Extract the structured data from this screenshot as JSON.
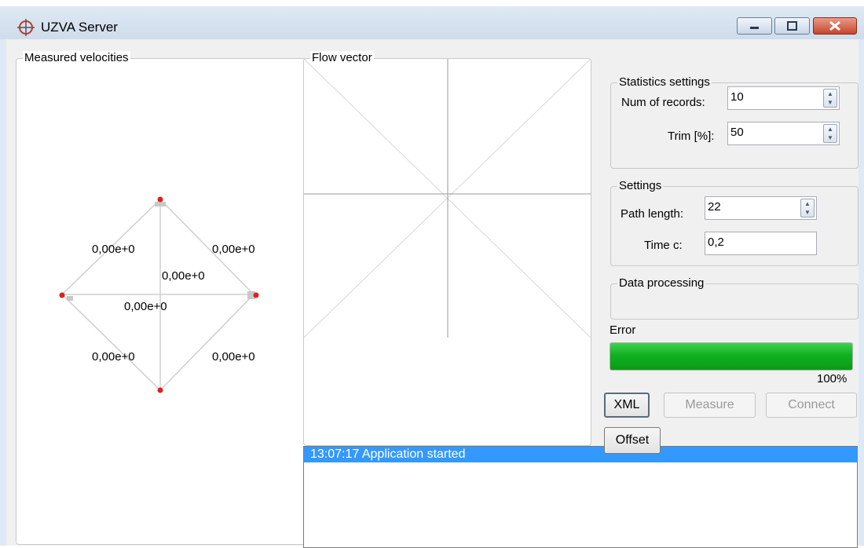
{
  "window": {
    "title": "UZVA Server"
  },
  "measured_velocities": {
    "label": "Measured velocities",
    "values": {
      "top_left": "0,00e+0",
      "top_right": "0,00e+0",
      "center_upper": "0,00e+0",
      "center_lower": "0,00e+0",
      "bottom_left": "0,00e+0",
      "bottom_right": "0,00e+0"
    }
  },
  "flow_vector": {
    "label": "Flow vector"
  },
  "statistics_settings": {
    "label": "Statistics settings",
    "num_records_label": "Num of records:",
    "num_records_value": "10",
    "trim_label": "Trim [%]:",
    "trim_value": "50"
  },
  "settings": {
    "label": "Settings",
    "path_length_label": "Path length:",
    "path_length_value": "22",
    "time_c_label": "Time c:",
    "time_c_value": "0,2"
  },
  "data_processing": {
    "label": "Data processing"
  },
  "error": {
    "label": "Error",
    "progress": 100,
    "progress_text": "100%"
  },
  "buttons": {
    "xml": "XML",
    "measure": "Measure",
    "connect": "Connect",
    "offset": "Offset"
  },
  "log": {
    "entries": [
      "13:07:17 Application started"
    ]
  }
}
